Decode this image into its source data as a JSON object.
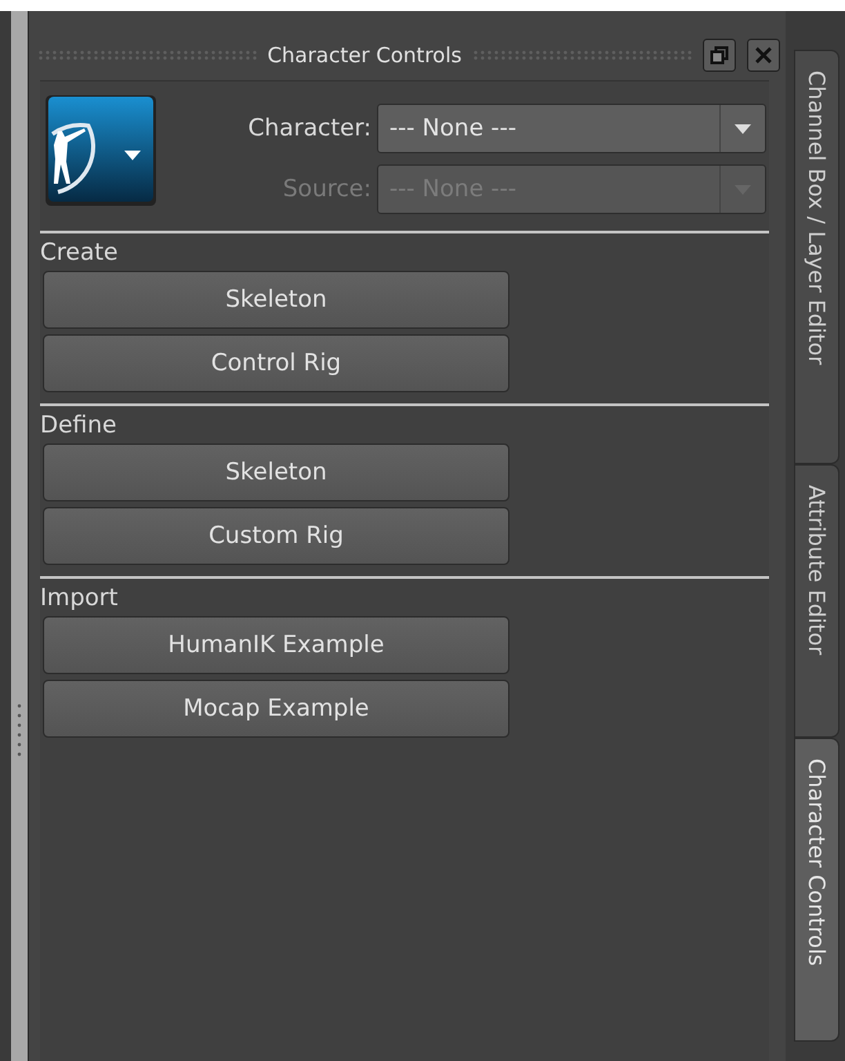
{
  "panel": {
    "title": "Character Controls"
  },
  "selectors": [
    {
      "label": "Character:",
      "value": "--- None ---",
      "disabled": false
    },
    {
      "label": "Source:",
      "value": "--- None ---",
      "disabled": true
    }
  ],
  "sections": [
    {
      "label": "Create",
      "buttons": [
        "Skeleton",
        "Control Rig"
      ]
    },
    {
      "label": "Define",
      "buttons": [
        "Skeleton",
        "Custom Rig"
      ]
    },
    {
      "label": "Import",
      "buttons": [
        "HumanIK Example",
        "Mocap Example"
      ]
    }
  ],
  "tabs": [
    {
      "label": "Channel Box / Layer Editor",
      "selected": false
    },
    {
      "label": "Attribute Editor",
      "selected": false
    },
    {
      "label": "Character Controls",
      "selected": true
    }
  ]
}
